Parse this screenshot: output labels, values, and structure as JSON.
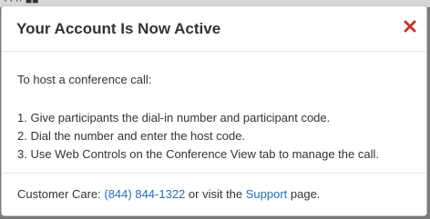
{
  "backdrop": {
    "text": "·'·'·· ■■"
  },
  "modal": {
    "title": "Your Account Is Now Active",
    "close_icon": "close-icon",
    "close_color": "#c0392b",
    "intro": "To host a conference call:",
    "steps": [
      "1. Give participants the dial-in number and participant code.",
      "2. Dial the number and enter the host code.",
      "3. Use Web Controls on the Conference View tab to manage the call."
    ],
    "footer": {
      "prefix": "Customer Care: ",
      "phone_link": "(844) 844-1322",
      "middle": " or visit the ",
      "support_link": "Support",
      "suffix": " page."
    },
    "link_color": "#2a6db5"
  }
}
